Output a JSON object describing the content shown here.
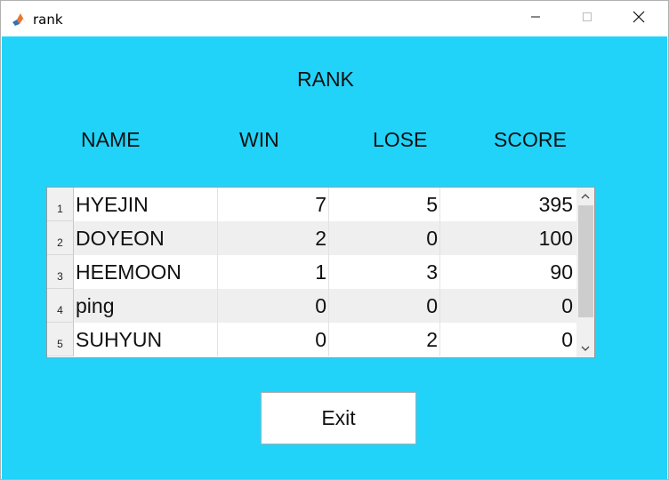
{
  "window": {
    "title": "rank",
    "icon": "matlab-icon",
    "controls": [
      "minimize-icon",
      "maximize-icon",
      "close-icon"
    ]
  },
  "colors": {
    "background": "#22d3f9",
    "table_alt_row": "#efefef",
    "button_face": "#ffffff"
  },
  "main": {
    "title": "RANK",
    "column_headers": {
      "name": "NAME",
      "win": "WIN",
      "lose": "LOSE",
      "score": "SCORE"
    }
  },
  "table": {
    "rows": [
      {
        "index": "1",
        "name": "HYEJIN",
        "win": "7",
        "lose": "5",
        "score": "395"
      },
      {
        "index": "2",
        "name": "DOYEON",
        "win": "2",
        "lose": "0",
        "score": "100"
      },
      {
        "index": "3",
        "name": "HEEMOON",
        "win": "1",
        "lose": "3",
        "score": "90"
      },
      {
        "index": "4",
        "name": "ping",
        "win": "0",
        "lose": "0",
        "score": "0"
      },
      {
        "index": "5",
        "name": "SUHYUN",
        "win": "0",
        "lose": "2",
        "score": "0"
      }
    ]
  },
  "buttons": {
    "exit_label": "Exit"
  }
}
